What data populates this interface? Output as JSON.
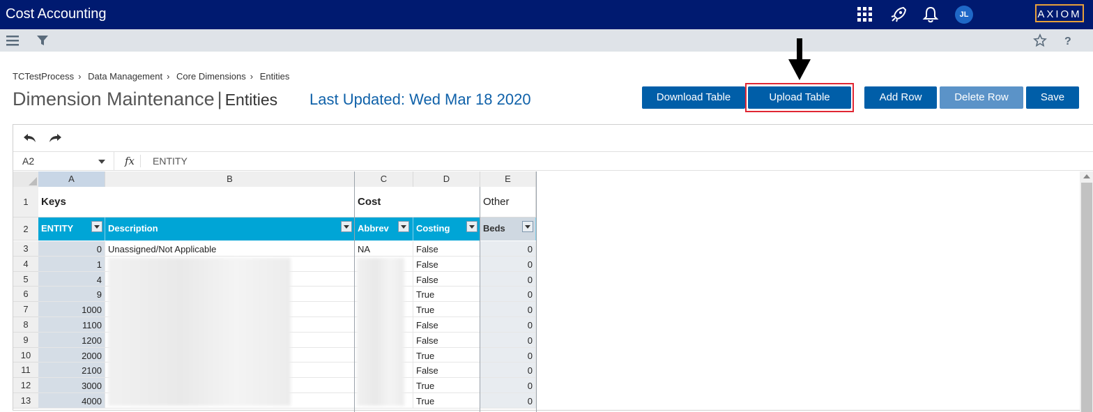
{
  "app": {
    "title": "Cost Accounting",
    "logo_text": "AXIOM",
    "user_initials": "JL"
  },
  "icons": {
    "apps": "grid-icon",
    "launch": "rocket-icon",
    "notifications": "bell-icon",
    "menu": "hamburger-icon",
    "filter": "filter-icon",
    "favorite": "star-icon",
    "help": "help-icon",
    "undo": "undo-icon",
    "redo": "redo-icon"
  },
  "breadcrumb": [
    "TCTestProcess",
    "Data Management",
    "Core Dimensions",
    "Entities"
  ],
  "breadcrumb_sep": "›",
  "page": {
    "title_prefix": "Dimension Maintenance",
    "pipe": "|",
    "title_entity": "Entities",
    "last_updated": "Last Updated: Wed Mar 18 2020"
  },
  "buttons": {
    "download": "Download Table",
    "upload": "Upload Table",
    "add_row": "Add Row",
    "delete_row": "Delete Row",
    "save": "Save"
  },
  "formula_bar": {
    "cell_ref": "A2",
    "fx": "fx",
    "value": "ENTITY"
  },
  "grid": {
    "columns": [
      "A",
      "B",
      "C",
      "D",
      "E"
    ],
    "row_numbers": [
      "1",
      "2",
      "3",
      "4",
      "5",
      "6",
      "7",
      "8",
      "9",
      "10",
      "11",
      "12",
      "13"
    ],
    "row1": {
      "keys": "Keys",
      "cost": "Cost",
      "other": "Other"
    },
    "headers": {
      "entity": "ENTITY",
      "description": "Description",
      "abbrev": "Abbrev",
      "costing": "Costing",
      "beds": "Beds"
    },
    "rows": [
      {
        "entity": "0",
        "description": "Unassigned/Not Applicable",
        "abbrev": "NA",
        "costing": "False",
        "beds": "0"
      },
      {
        "entity": "1",
        "description": "",
        "abbrev": "",
        "costing": "False",
        "beds": "0"
      },
      {
        "entity": "4",
        "description": "",
        "abbrev": "",
        "costing": "False",
        "beds": "0"
      },
      {
        "entity": "9",
        "description": "",
        "abbrev": "",
        "costing": "True",
        "beds": "0"
      },
      {
        "entity": "1000",
        "description": "",
        "abbrev": "",
        "costing": "True",
        "beds": "0"
      },
      {
        "entity": "1100",
        "description": "",
        "abbrev": "",
        "costing": "False",
        "beds": "0"
      },
      {
        "entity": "1200",
        "description": "",
        "abbrev": "",
        "costing": "False",
        "beds": "0"
      },
      {
        "entity": "2000",
        "description": "",
        "abbrev": "",
        "costing": "True",
        "beds": "0"
      },
      {
        "entity": "2100",
        "description": "",
        "abbrev": "",
        "costing": "False",
        "beds": "0"
      },
      {
        "entity": "3000",
        "description": "",
        "abbrev": "",
        "costing": "True",
        "beds": "0"
      },
      {
        "entity": "4000",
        "description": "",
        "abbrev": "",
        "costing": "True",
        "beds": "0"
      }
    ]
  },
  "colors": {
    "topbar": "#001a70",
    "button": "#005ea8",
    "header": "#00a5d6",
    "highlight": "#e02633"
  }
}
